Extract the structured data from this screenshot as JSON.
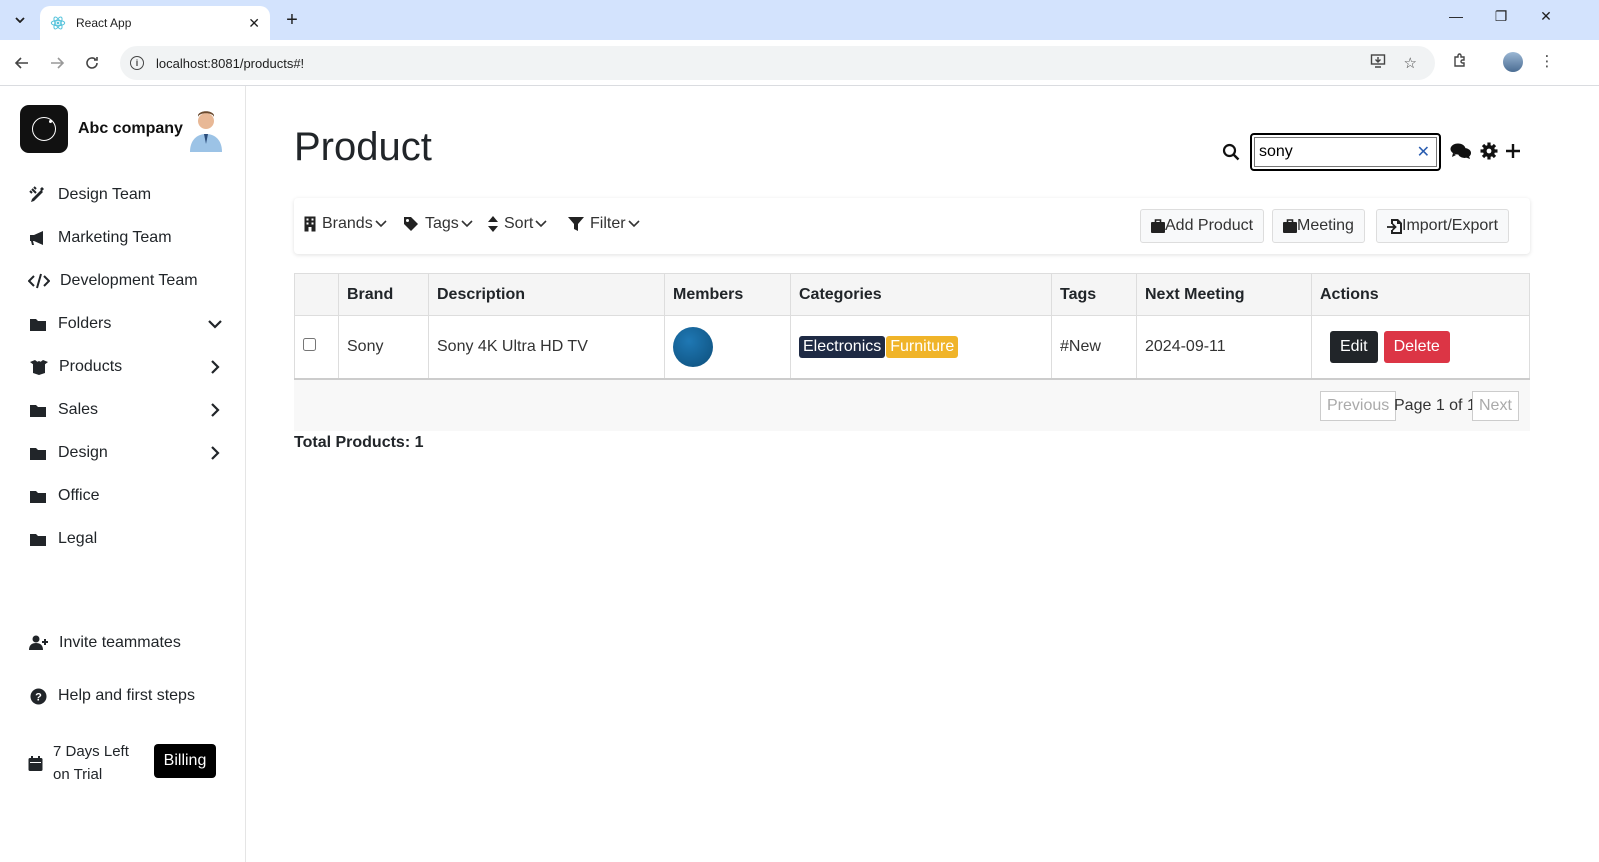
{
  "browser": {
    "tab_title": "React App",
    "url": "localhost:8081/products#!"
  },
  "sidebar": {
    "company": "Abc company",
    "items": [
      {
        "label": "Design Team",
        "icon": "pen-ruler-icon"
      },
      {
        "label": "Marketing Team",
        "icon": "bullhorn-icon"
      },
      {
        "label": "Development Team",
        "icon": "code-icon"
      },
      {
        "label": "Folders",
        "icon": "folder-icon",
        "chevron": "down"
      },
      {
        "label": "Products",
        "icon": "box-open-icon",
        "chevron": "right"
      },
      {
        "label": "Sales",
        "icon": "folder-icon",
        "chevron": "right"
      },
      {
        "label": "Design",
        "icon": "folder-icon",
        "chevron": "right"
      },
      {
        "label": "Office",
        "icon": "folder-icon"
      },
      {
        "label": "Legal",
        "icon": "folder-icon"
      }
    ],
    "invite": "Invite teammates",
    "help": "Help and first steps",
    "trial": "7 Days Left on Trial",
    "billing": "Billing"
  },
  "main": {
    "title": "Product",
    "search_value": "sony",
    "toolbar": {
      "brands": "Brands",
      "tags": "Tags",
      "sort": "Sort",
      "filter": "Filter",
      "add_product": "Add Product",
      "meeting": "Meeting",
      "import_export": "Import/Export"
    },
    "table": {
      "headers": [
        "",
        "Brand",
        "Description",
        "Members",
        "Categories",
        "Tags",
        "Next Meeting",
        "Actions"
      ],
      "rows": [
        {
          "brand": "Sony",
          "description": "Sony 4K Ultra HD TV",
          "categories": [
            {
              "label": "Electronics",
              "color": "#1e2a44"
            },
            {
              "label": "Furniture",
              "color": "#f0b429"
            }
          ],
          "tags": "#New",
          "next_meeting": "2024-09-11",
          "edit": "Edit",
          "delete": "Delete"
        }
      ]
    },
    "pagination": {
      "previous": "Previous",
      "page_text": "Page 1 of 1",
      "next": "Next"
    },
    "total": "Total Products: 1"
  }
}
